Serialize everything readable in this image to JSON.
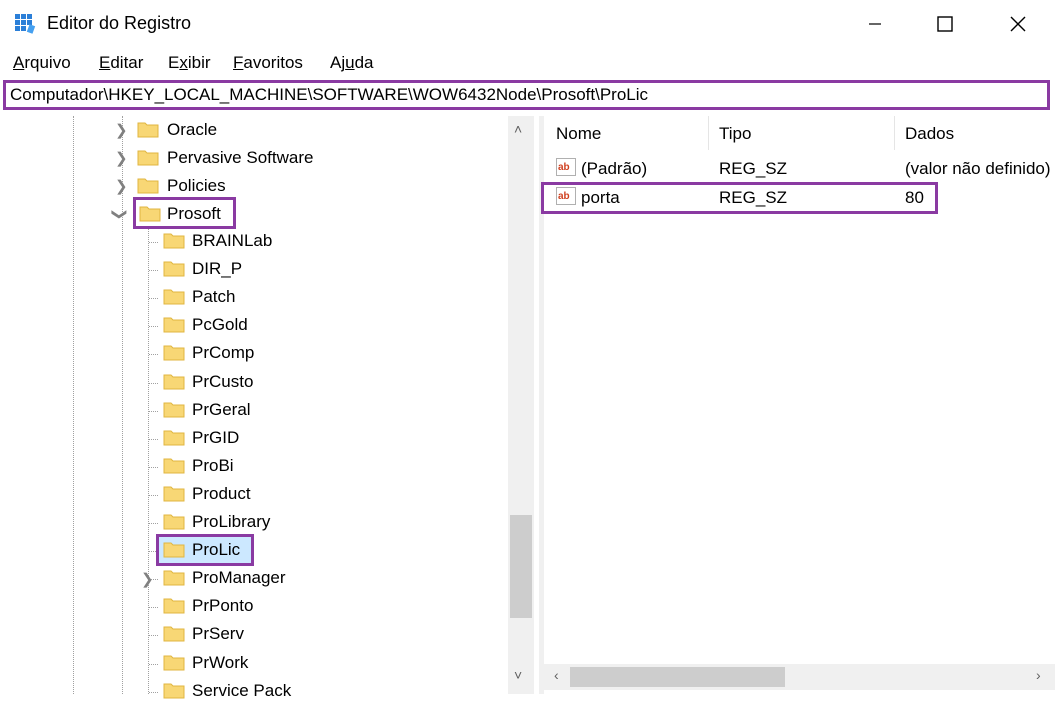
{
  "window": {
    "title": "Editor do Registro"
  },
  "menu": [
    {
      "label": "Arquivo",
      "key": "A",
      "rest": "rquivo"
    },
    {
      "label": "Editar",
      "key": "E",
      "rest": "ditar"
    },
    {
      "label": "Exibir",
      "key": "x",
      "pre": "E",
      "rest": "ibir"
    },
    {
      "label": "Favoritos",
      "key": "F",
      "rest": "avoritos"
    },
    {
      "label": "Ajuda",
      "key": "u",
      "pre": "Aj",
      "rest": "da"
    }
  ],
  "address": "Computador\\HKEY_LOCAL_MACHINE\\SOFTWARE\\WOW6432Node\\Prosoft\\ProLic",
  "tree": {
    "parents": [
      "Oracle",
      "Pervasive Software",
      "Policies",
      "Prosoft"
    ],
    "children": [
      "BRAINLab",
      "DIR_P",
      "Patch",
      "PcGold",
      "PrComp",
      "PrCusto",
      "PrGeral",
      "PrGID",
      "ProBi",
      "Product",
      "ProLibrary",
      "ProLic",
      "ProManager",
      "PrPonto",
      "PrServ",
      "PrWork",
      "Service Pack"
    ]
  },
  "list": {
    "headers": {
      "name": "Nome",
      "type": "Tipo",
      "data": "Dados"
    },
    "rows": [
      {
        "name": "(Padrão)",
        "type": "REG_SZ",
        "data": "(valor não definido)"
      },
      {
        "name": "porta",
        "type": "REG_SZ",
        "data": "80"
      }
    ]
  },
  "colors": {
    "highlight": "#8a3aa2",
    "selection": "#cce8ff",
    "folder": "#f8d775"
  },
  "icons": {
    "app": "registry-editor-icon",
    "folder": "folder-icon",
    "value": "reg-sz-ab-icon"
  }
}
